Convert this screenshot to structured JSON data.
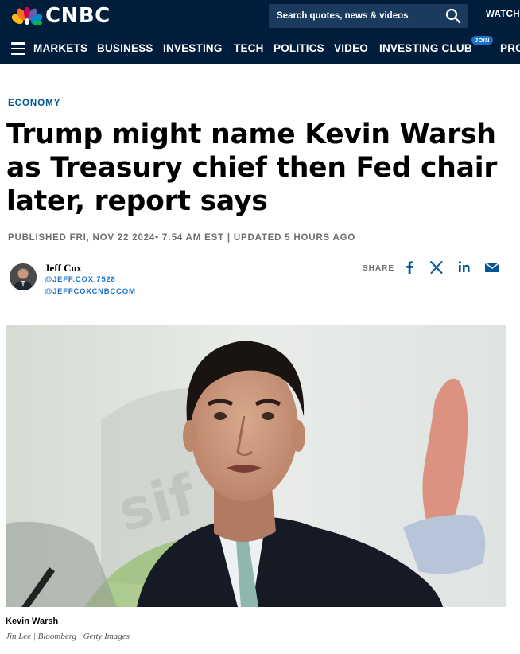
{
  "header": {
    "logo_text": "CNBC",
    "search_placeholder": "Search quotes, news & videos",
    "watch_label": "WATCH",
    "join_badge": "JOIN",
    "nav": [
      "MARKETS",
      "BUSINESS",
      "INVESTING",
      "TECH",
      "POLITICS",
      "VIDEO",
      "INVESTING CLUB",
      "PRO"
    ]
  },
  "article": {
    "section": "ECONOMY",
    "headline": "Trump might name Kevin Warsh as Treasury chief then Fed chair later, report says",
    "published": "PUBLISHED FRI, NOV 22 2024• 7:54 AM EST | UPDATED 5 HOURS AGO",
    "author": {
      "name": "Jeff Cox",
      "handle1": "@JEFF.COX.7528",
      "handle2": "@JEFFCOXCNBCCOM"
    },
    "share_label": "SHARE",
    "share_icons": [
      "facebook-icon",
      "x-icon",
      "linkedin-icon",
      "email-icon"
    ],
    "photo": {
      "caption": "Kevin Warsh",
      "credit": "Jin Lee | Bloomberg | Getty Images"
    }
  },
  "colors": {
    "header_bg": "#001E3C",
    "section": "#005594",
    "link": "#1a73c8"
  }
}
